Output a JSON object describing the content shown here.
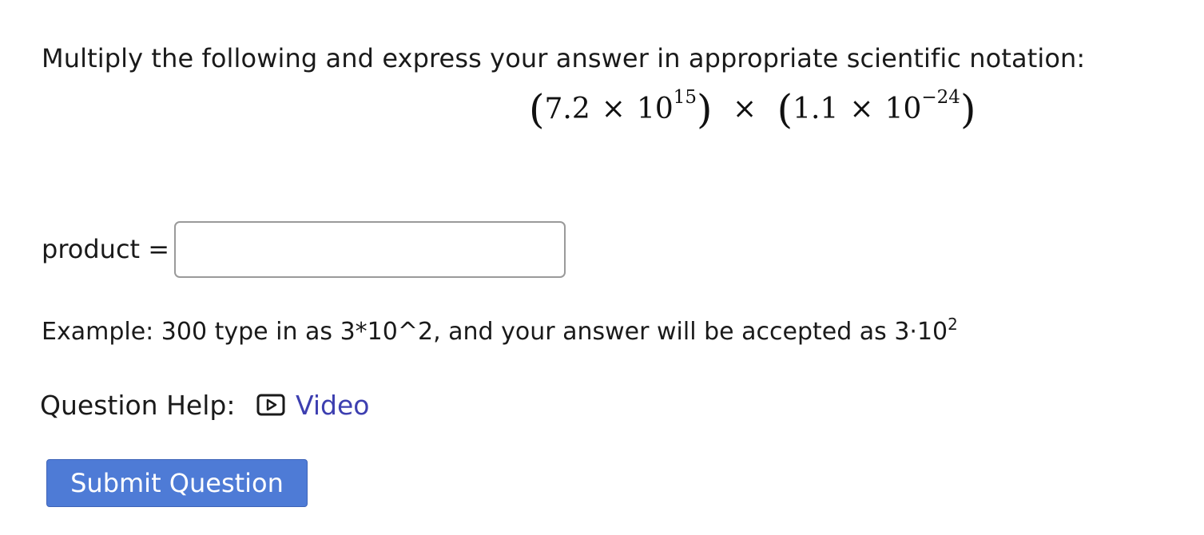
{
  "question": {
    "prompt": "Multiply the following and express your answer in appropriate scientific notation:",
    "expression": {
      "open_paren": "(",
      "close_paren": ")",
      "times_symbol": "×",
      "first": {
        "coefficient": "7.2",
        "base": "10",
        "exponent": "15"
      },
      "second": {
        "coefficient": "1.1",
        "base": "10",
        "exponent": "−24"
      }
    }
  },
  "answer": {
    "label": "product =",
    "value": "",
    "placeholder": ""
  },
  "example": {
    "text": "Example: 300 type in as 3*10^2, and your answer will be accepted as 3·10",
    "exponent": "2"
  },
  "help": {
    "label": "Question Help:",
    "video_label": "Video",
    "video_icon": "play-video-icon"
  },
  "actions": {
    "submit_label": "Submit Question",
    "submit_color": "#4e7bd6"
  },
  "colors": {
    "link": "#3d3fb0",
    "text": "#1a1a1a",
    "input_border": "#9a9a9a"
  }
}
